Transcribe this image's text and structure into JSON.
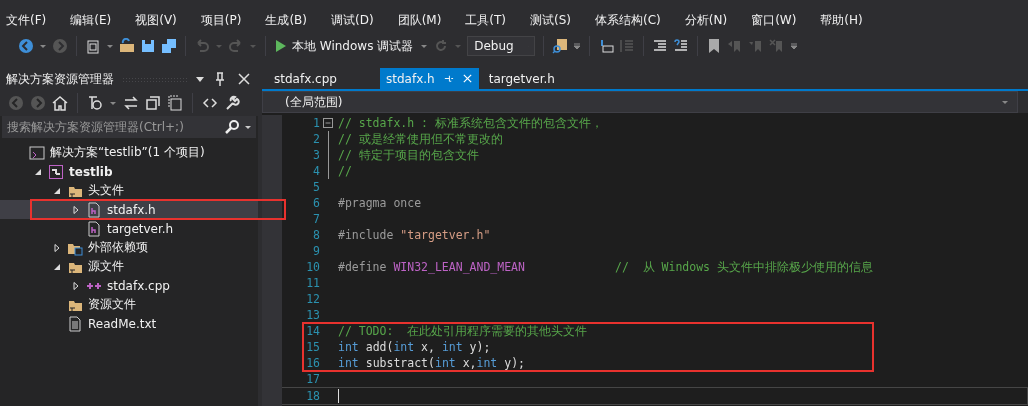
{
  "menu": [
    "文件(F)",
    "编辑(E)",
    "视图(V)",
    "项目(P)",
    "生成(B)",
    "调试(D)",
    "团队(M)",
    "工具(T)",
    "测试(S)",
    "体系结构(C)",
    "分析(N)",
    "窗口(W)",
    "帮助(H)"
  ],
  "toolbar": {
    "debugger": "本地 Windows 调试器",
    "configuration": "Debug"
  },
  "solution_explorer": {
    "title": "解决方案资源管理器",
    "search": {
      "placeholder": "搜索解决方案资源管理器(Ctrl+;)"
    },
    "tree": [
      {
        "kind": "solution",
        "label": "解决方案“testlib”(1 个项目)",
        "selected": false,
        "children": [
          {
            "kind": "project",
            "label": "testlib",
            "expanded": true,
            "selected": false,
            "children": [
              {
                "kind": "folder",
                "label": "头文件",
                "expanded": true,
                "selected": false,
                "children": [
                  {
                    "kind": "header",
                    "label": "stdafx.h",
                    "expanded": false,
                    "selected": true
                  },
                  {
                    "kind": "header",
                    "label": "targetver.h",
                    "selected": false
                  }
                ]
              },
              {
                "kind": "deps",
                "label": "外部依赖项",
                "expanded": false,
                "selected": false
              },
              {
                "kind": "folder",
                "label": "源文件",
                "expanded": true,
                "selected": false,
                "children": [
                  {
                    "kind": "cpp",
                    "label": "stdafx.cpp",
                    "expanded": false,
                    "selected": false
                  }
                ]
              },
              {
                "kind": "folder",
                "label": "资源文件",
                "selected": false
              },
              {
                "kind": "text",
                "label": "ReadMe.txt",
                "selected": false
              }
            ]
          }
        ]
      }
    ]
  },
  "tabs": [
    {
      "label": "stdafx.cpp",
      "selected": false
    },
    {
      "label": "stdafx.h",
      "selected": true
    },
    {
      "label": "targetver.h",
      "selected": false
    }
  ],
  "scope": "(全局范围)",
  "code": [
    {
      "number": "1",
      "tokens": [
        {
          "kind": "comment",
          "text": "// stdafx.h : 标准系统包含文件的包含文件，"
        }
      ]
    },
    {
      "number": "2",
      "tokens": [
        {
          "kind": "comment",
          "text": "// 或是经常使用但不常更改的"
        }
      ]
    },
    {
      "number": "3",
      "tokens": [
        {
          "kind": "comment",
          "text": "// 特定于项目的包含文件"
        }
      ]
    },
    {
      "number": "4",
      "tokens": [
        {
          "kind": "comment",
          "text": "//"
        }
      ]
    },
    {
      "number": "5"
    },
    {
      "number": "6",
      "tokens": [
        {
          "kind": "preproc",
          "text": "#pragma once"
        }
      ]
    },
    {
      "number": "7"
    },
    {
      "number": "8",
      "tokens": [
        {
          "kind": "preproc",
          "text": "#include "
        },
        {
          "kind": "string",
          "text": "\"targetver.h\""
        }
      ]
    },
    {
      "number": "9"
    },
    {
      "number": "10",
      "tokens": [
        {
          "kind": "preproc",
          "text": "#define "
        },
        {
          "kind": "macro",
          "text": "WIN32_LEAN_AND_MEAN"
        },
        {
          "kind": "comment",
          "text": "             //  从 Windows 头文件中排除极少使用的信息"
        }
      ]
    },
    {
      "number": "11"
    },
    {
      "number": "12"
    },
    {
      "number": "13"
    },
    {
      "number": "14",
      "tokens": [
        {
          "kind": "comment",
          "text": "// TODO:  在此处引用程序需要的其他头文件"
        }
      ]
    },
    {
      "number": "15",
      "tokens": [
        {
          "kind": "keyword",
          "text": "int"
        },
        {
          "kind": "plain",
          "text": " add("
        },
        {
          "kind": "keyword",
          "text": "int"
        },
        {
          "kind": "plain",
          "text": " x, "
        },
        {
          "kind": "keyword",
          "text": "int"
        },
        {
          "kind": "plain",
          "text": " y);"
        }
      ]
    },
    {
      "number": "16",
      "tokens": [
        {
          "kind": "keyword",
          "text": "int"
        },
        {
          "kind": "plain",
          "text": " substract("
        },
        {
          "kind": "keyword",
          "text": "int"
        },
        {
          "kind": "plain",
          "text": " x,"
        },
        {
          "kind": "keyword",
          "text": "int"
        },
        {
          "kind": "plain",
          "text": " y);"
        }
      ]
    },
    {
      "number": "17"
    },
    {
      "number": "18"
    }
  ]
}
